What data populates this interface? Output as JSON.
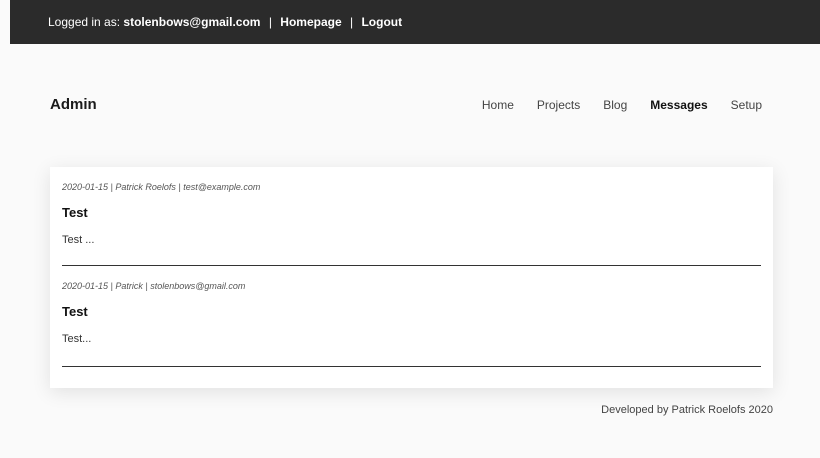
{
  "topbar": {
    "logged_in_prefix": "Logged in as:",
    "user_email": "stolenbows@gmail.com",
    "separator": "|",
    "homepage_link": "Homepage",
    "logout_link": "Logout"
  },
  "header": {
    "brand": "Admin",
    "nav": [
      {
        "label": "Home",
        "active": false
      },
      {
        "label": "Projects",
        "active": false
      },
      {
        "label": "Blog",
        "active": false
      },
      {
        "label": "Messages",
        "active": true
      },
      {
        "label": "Setup",
        "active": false
      }
    ]
  },
  "messages": [
    {
      "meta": "2020-01-15 | Patrick Roelofs | test@example.com",
      "subject": "Test",
      "body": "Test ..."
    },
    {
      "meta": "2020-01-15 | Patrick | stolenbows@gmail.com",
      "subject": "Test",
      "body": "Test..."
    }
  ],
  "footer": {
    "text": "Developed by Patrick Roelofs 2020"
  }
}
